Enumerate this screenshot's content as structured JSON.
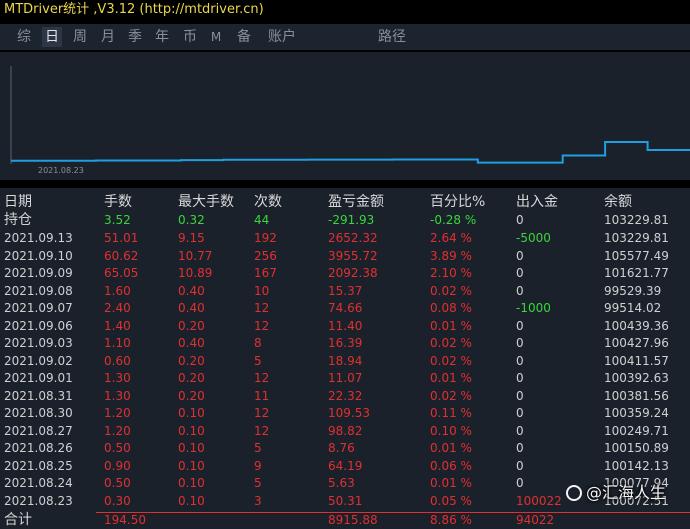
{
  "window": {
    "title": "MTDriver统计 ,V3.12 (http://mtdriver.cn)"
  },
  "tabs": [
    {
      "label": "综",
      "active": false
    },
    {
      "label": "日",
      "active": true
    },
    {
      "label": "周",
      "active": false
    },
    {
      "label": "月",
      "active": false
    },
    {
      "label": "季",
      "active": false
    },
    {
      "label": "年",
      "active": false
    },
    {
      "label": "币",
      "active": false
    },
    {
      "label": "M",
      "active": false
    },
    {
      "label": "备",
      "active": false
    },
    {
      "label": "账户",
      "active": false
    },
    {
      "label": "路径",
      "active": false
    }
  ],
  "chart_data": {
    "type": "line",
    "x_tick_label": "2021.08.23",
    "series_color": "#1e9fe0",
    "x": [
      "2021.08.23",
      "2021.08.24",
      "2021.08.25",
      "2021.08.26",
      "2021.08.27",
      "2021.08.30",
      "2021.08.31",
      "2021.09.01",
      "2021.09.02",
      "2021.09.03",
      "2021.09.06",
      "2021.09.07",
      "2021.09.08",
      "2021.09.09",
      "2021.09.10",
      "2021.09.13"
    ],
    "values": [
      100072.51,
      100077.94,
      100142.13,
      100150.89,
      100249.71,
      100359.24,
      100381.56,
      100392.63,
      100411.57,
      100427.96,
      100439.36,
      99514.02,
      99529.39,
      101621.77,
      105577.49,
      103229.81
    ]
  },
  "table": {
    "headers": [
      "日期",
      "手数",
      "最大手数",
      "次数",
      "盈亏金额",
      "百分比%",
      "出入金",
      "余额"
    ],
    "holding": {
      "label": "持仓",
      "lots": "3.52",
      "max_lots": "0.32",
      "count": "44",
      "pnl": "-291.93",
      "pct": "-0.28 %",
      "flow": "0",
      "balance": "103229.81"
    },
    "rows": [
      {
        "date": "2021.09.13",
        "lots": "51.01",
        "max_lots": "9.15",
        "count": "192",
        "pnl": "2652.32",
        "pct": "2.64 %",
        "flow": "-5000",
        "balance": "103229.81",
        "flow_color": "green"
      },
      {
        "date": "2021.09.10",
        "lots": "60.62",
        "max_lots": "10.77",
        "count": "256",
        "pnl": "3955.72",
        "pct": "3.89 %",
        "flow": "0",
        "balance": "105577.49",
        "flow_color": "white"
      },
      {
        "date": "2021.09.09",
        "lots": "65.05",
        "max_lots": "10.89",
        "count": "167",
        "pnl": "2092.38",
        "pct": "2.10 %",
        "flow": "0",
        "balance": "101621.77",
        "flow_color": "white"
      },
      {
        "date": "2021.09.08",
        "lots": "1.60",
        "max_lots": "0.40",
        "count": "10",
        "pnl": "15.37",
        "pct": "0.02 %",
        "flow": "0",
        "balance": "99529.39",
        "flow_color": "white"
      },
      {
        "date": "2021.09.07",
        "lots": "2.40",
        "max_lots": "0.40",
        "count": "12",
        "pnl": "74.66",
        "pct": "0.08 %",
        "flow": "-1000",
        "balance": "99514.02",
        "flow_color": "green"
      },
      {
        "date": "2021.09.06",
        "lots": "1.40",
        "max_lots": "0.20",
        "count": "12",
        "pnl": "11.40",
        "pct": "0.01 %",
        "flow": "0",
        "balance": "100439.36",
        "flow_color": "white"
      },
      {
        "date": "2021.09.03",
        "lots": "1.10",
        "max_lots": "0.40",
        "count": "8",
        "pnl": "16.39",
        "pct": "0.02 %",
        "flow": "0",
        "balance": "100427.96",
        "flow_color": "white"
      },
      {
        "date": "2021.09.02",
        "lots": "0.60",
        "max_lots": "0.20",
        "count": "5",
        "pnl": "18.94",
        "pct": "0.02 %",
        "flow": "0",
        "balance": "100411.57",
        "flow_color": "white"
      },
      {
        "date": "2021.09.01",
        "lots": "1.30",
        "max_lots": "0.20",
        "count": "12",
        "pnl": "11.07",
        "pct": "0.01 %",
        "flow": "0",
        "balance": "100392.63",
        "flow_color": "white"
      },
      {
        "date": "2021.08.31",
        "lots": "1.30",
        "max_lots": "0.20",
        "count": "11",
        "pnl": "22.32",
        "pct": "0.02 %",
        "flow": "0",
        "balance": "100381.56",
        "flow_color": "white"
      },
      {
        "date": "2021.08.30",
        "lots": "1.20",
        "max_lots": "0.10",
        "count": "12",
        "pnl": "109.53",
        "pct": "0.11 %",
        "flow": "0",
        "balance": "100359.24",
        "flow_color": "white"
      },
      {
        "date": "2021.08.27",
        "lots": "1.20",
        "max_lots": "0.10",
        "count": "12",
        "pnl": "98.82",
        "pct": "0.10 %",
        "flow": "0",
        "balance": "100249.71",
        "flow_color": "white"
      },
      {
        "date": "2021.08.26",
        "lots": "0.50",
        "max_lots": "0.10",
        "count": "5",
        "pnl": "8.76",
        "pct": "0.01 %",
        "flow": "0",
        "balance": "100150.89",
        "flow_color": "white"
      },
      {
        "date": "2021.08.25",
        "lots": "0.90",
        "max_lots": "0.10",
        "count": "9",
        "pnl": "64.19",
        "pct": "0.06 %",
        "flow": "0",
        "balance": "100142.13",
        "flow_color": "white"
      },
      {
        "date": "2021.08.24",
        "lots": "0.50",
        "max_lots": "0.10",
        "count": "5",
        "pnl": "5.63",
        "pct": "0.01 %",
        "flow": "0",
        "balance": "100077.94",
        "flow_color": "white"
      },
      {
        "date": "2021.08.23",
        "lots": "0.30",
        "max_lots": "0.10",
        "count": "3",
        "pnl": "50.31",
        "pct": "0.05 %",
        "flow": "100022",
        "balance": "100072.51",
        "flow_color": "red"
      }
    ],
    "total": {
      "label": "合计",
      "lots": "194.50",
      "pnl": "8915.88",
      "pct": "8.86 %",
      "flow": "94022"
    }
  },
  "watermark": {
    "text": "@汇海人生"
  },
  "colors": {
    "background": "#1a212b",
    "tabbar": "#1c2430",
    "title": "#e8d84a",
    "profit": "#e03030",
    "positive_flow": "#3ad63a",
    "line": "#1e9fe0"
  }
}
